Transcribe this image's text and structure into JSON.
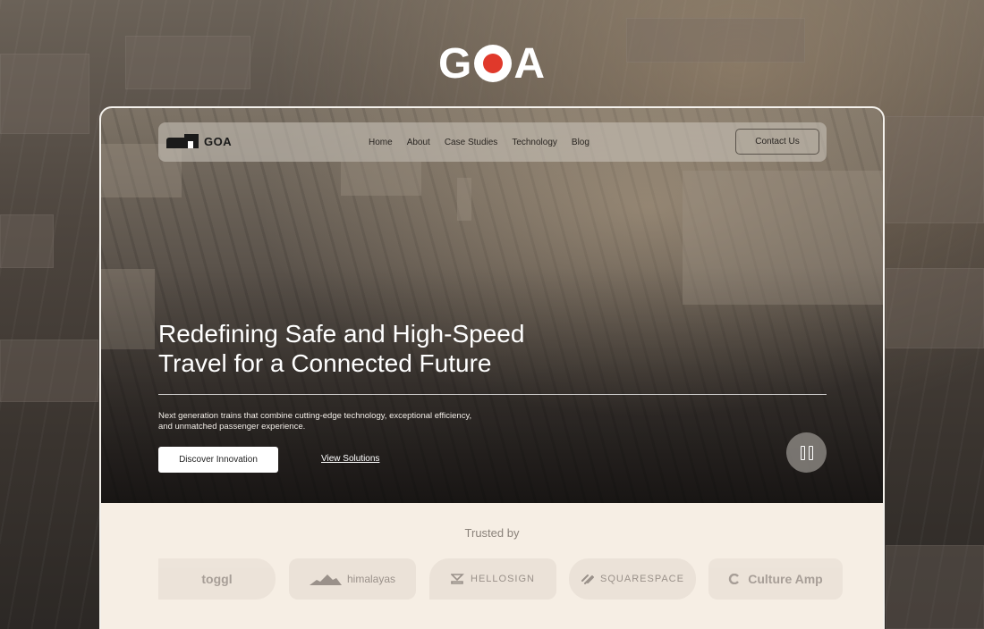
{
  "brand": {
    "name": "GOA"
  },
  "navbar": {
    "logo_text": "GOA",
    "links": [
      "Home",
      "About",
      "Case Studies",
      "Technology",
      "Blog"
    ],
    "cta_label": "Contact Us"
  },
  "hero": {
    "title": "Redefining Safe and High-Speed Travel for a Connected Future",
    "description": "Next generation trains that combine cutting-edge technology, exceptional efficiency, and unmatched passenger experience.",
    "primary_button": "Discover Innovation",
    "secondary_link": "View Solutions",
    "pause_icon": "pause-icon"
  },
  "trusted": {
    "heading": "Trusted by",
    "logos": [
      "toggl",
      "himalayas",
      "HELLOSIGN",
      "SQUARESPACE",
      "Culture Amp"
    ]
  },
  "colors": {
    "accent_red": "#e0392b",
    "cream": "#f6eee4",
    "pill": "#ebe2d8"
  }
}
